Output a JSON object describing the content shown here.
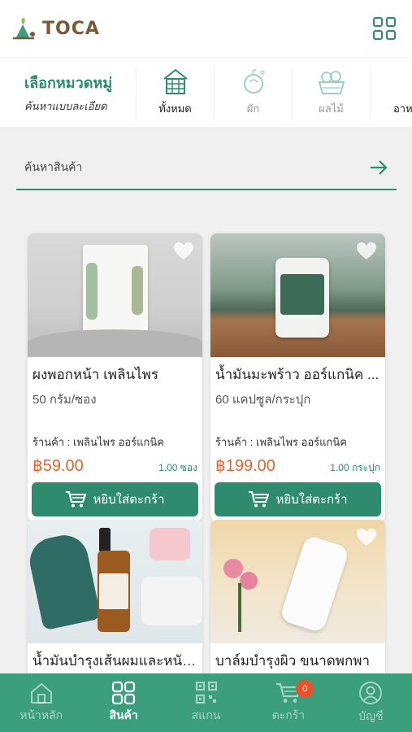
{
  "app": {
    "name": "TOCA",
    "brand_color": "#2e8b6e",
    "accent_price": "#e0662e"
  },
  "categories": {
    "title": "เลือกหมวดหมู่",
    "subtitle": "ค้นหาแบบละเอียด",
    "items": [
      {
        "label": "ทั้งหมด",
        "icon": "all-products-icon",
        "active": true
      },
      {
        "label": "ผัก",
        "icon": "vegetable-icon",
        "active": false
      },
      {
        "label": "ผลไม้",
        "icon": "fruit-basket-icon",
        "active": false
      },
      {
        "label": "อาห",
        "icon": "food-icon",
        "active": false
      }
    ]
  },
  "search": {
    "placeholder": "ค้นหาสินค้า"
  },
  "products": [
    {
      "name": "ผงพอกหน้า เพลินไพร",
      "unit": "50 กรัม/ซอง",
      "shop": "ร้านค้า : เพลินไพร ออร์แกนิค",
      "price": "฿59.00",
      "qty": "1.00 ซอง",
      "add_label": "หยิบใส่ตะกร้า"
    },
    {
      "name": "น้ำมันมะพร้าว ออร์แกนิค ...",
      "unit": "60 แคปซูล/กระปุก",
      "shop": "ร้านค้า : เพลินไพร ออร์แกนิค",
      "price": "฿199.00",
      "qty": "1.00 กระปุก",
      "add_label": "หยิบใส่ตะกร้า"
    },
    {
      "name": "น้ำมันบำรุงเส้นผมและหนัง..."
    },
    {
      "name": "บาล์มบำรุงผิว ขนาดพกพา"
    }
  ],
  "nav": {
    "items": [
      {
        "label": "หน้าหลัก",
        "icon": "home-icon"
      },
      {
        "label": "สินค้า",
        "icon": "grid-icon"
      },
      {
        "label": "สแกน",
        "icon": "qr-code-icon"
      },
      {
        "label": "ตะกร้า",
        "icon": "cart-icon"
      },
      {
        "label": "บัญชี",
        "icon": "account-icon"
      }
    ],
    "cart_badge": "0"
  }
}
